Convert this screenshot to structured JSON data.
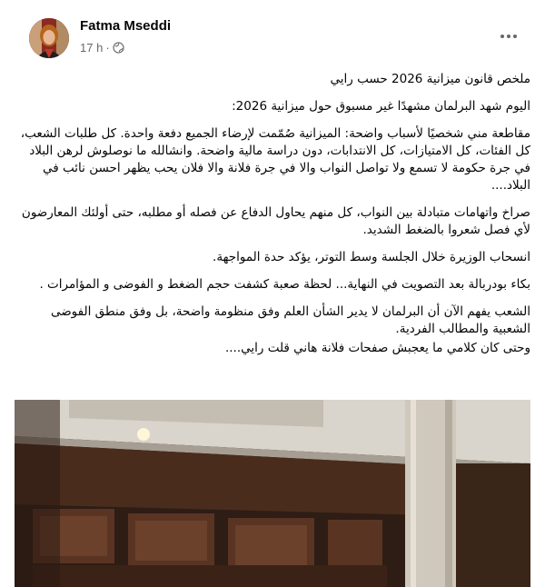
{
  "post": {
    "author": "Fatma Mseddi",
    "time": "17 h",
    "separator": "·",
    "privacy_icon": "globe-icon",
    "more_icon": "more-options-icon",
    "paragraphs": [
      "ملخص قانون ميزانية 2026  حسب رايي",
      "اليوم شهد البرلمان مشهدًا غير مسبوق حول ميزانية 2026:",
      "مقاطعة مني شخصيًا لأسباب واضحة: الميزانية صُمّمت لإرضاء الجميع دفعة واحدة. كل طلبات الشعب، كل الفئات، كل الامتيازات، كل الانتدابات، دون دراسة مالية واضحة. وانشالله ما نوصلوش لرهن البلاد في جرة حكومة لا تسمع ولا تواصل النواب والا في جرة فلانة والا فلان يحب يظهر احسن نائب في البلاد....",
      "صراخ واتهامات متبادلة بين النواب، كل منهم يحاول الدفاع عن فصله أو مطلبه، حتى أولئك المعارضون لأي فصل شعروا بالضغط الشديد.",
      "انسحاب الوزيرة خلال الجلسة وسط التوتر، يؤكد حدة المواجهة.",
      "بكاء بودربالة بعد التصويت  في النهاية... لحظة صعبة كشفت حجم الضغط و الفوضى و المؤامرات .",
      "الشعب يفهم الآن أن البرلمان لا يدير الشأن العلم وفق منظومة واضحة، بل وفق منطق الفوضى الشعبية والمطالب الفردية.",
      "وحتى كان كلامي ما يعجبش صفحات فلانة  هاني قلت رايي...."
    ],
    "photo": {
      "icon": "parliament-photo",
      "colors": {
        "wood": "#5a3422",
        "wood_dark": "#3b2216",
        "ceiling": "#d9d4cc",
        "column": "#cfc8bc"
      }
    }
  }
}
